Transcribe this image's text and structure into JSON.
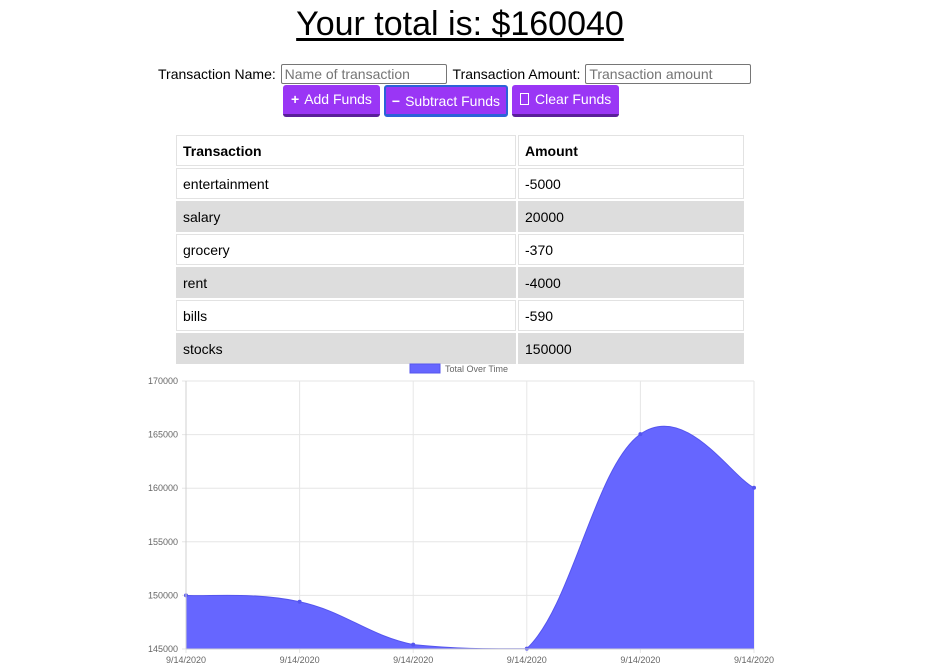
{
  "header": {
    "total_title": "Your total is: $160040"
  },
  "form": {
    "name_label": "Transaction Name:",
    "name_placeholder": "Name of transaction",
    "name_value": "",
    "amount_label": "Transaction Amount:",
    "amount_placeholder": "Transaction amount",
    "amount_value": ""
  },
  "buttons": {
    "add": {
      "icon": "plus-icon",
      "glyph": "+",
      "label": "Add Funds"
    },
    "subtract": {
      "icon": "minus-icon",
      "glyph": "−",
      "label": "Subtract Funds"
    },
    "clear": {
      "icon": "missing-glyph-box-icon",
      "label": "Clear Funds"
    }
  },
  "table": {
    "headers": [
      "Transaction",
      "Amount"
    ],
    "rows": [
      [
        "entertainment",
        "-5000"
      ],
      [
        "salary",
        "20000"
      ],
      [
        "grocery",
        "-370"
      ],
      [
        "rent",
        "-4000"
      ],
      [
        "bills",
        "-590"
      ],
      [
        "stocks",
        "150000"
      ]
    ]
  },
  "colors": {
    "button": "#9a36f5",
    "chart_fill": "#6666ff",
    "row_alt": "#dddddd"
  },
  "chart_data": {
    "type": "area",
    "legend": "Total Over Time",
    "legend_position": "top",
    "x": [
      "9/14/2020",
      "9/14/2020",
      "9/14/2020",
      "9/14/2020",
      "9/14/2020",
      "9/14/2020"
    ],
    "series": [
      {
        "name": "Total Over Time",
        "values": [
          150000,
          149410,
          145410,
          145040,
          165040,
          160040
        ]
      }
    ],
    "ylim": [
      145000,
      170000
    ],
    "yticks": [
      "170000",
      "165000",
      "160000",
      "155000",
      "150000",
      "145000"
    ],
    "grid": true
  }
}
